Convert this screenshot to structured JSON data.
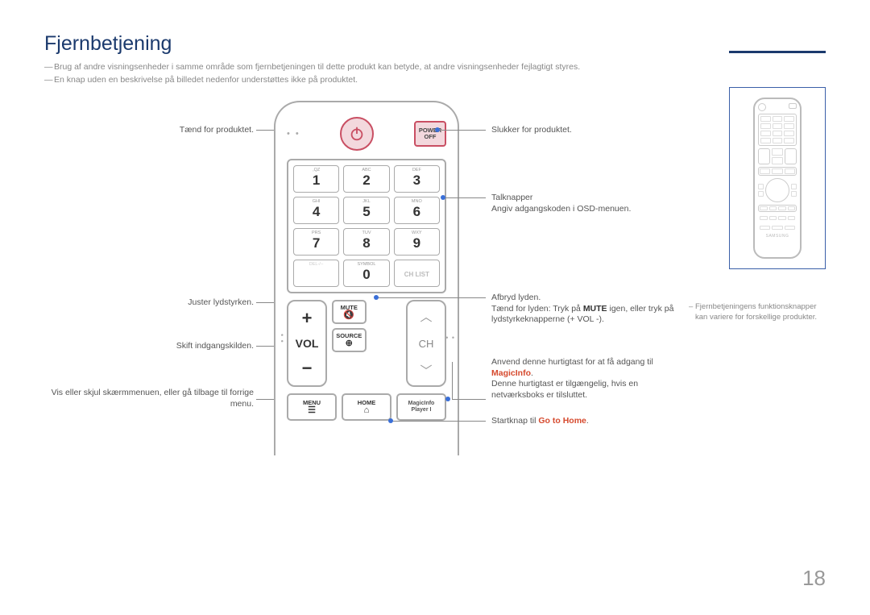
{
  "title": "Fjernbetjening",
  "notes": {
    "n1": "Brug af andre visningsenheder i samme område som fjernbetjeningen til dette produkt kan betyde, at andre visningsenheder fejlagtigt styres.",
    "n2": "En knap uden en beskrivelse på billedet nedenfor understøttes ikke på produktet."
  },
  "pageNumber": "18",
  "left": {
    "power_on": "Tænd for produktet.",
    "vol": "Juster lydstyrken.",
    "source": "Skift indgangskilden.",
    "menu": "Vis eller skjul skærmmenuen, eller gå tilbage til forrige menu."
  },
  "right": {
    "power_off": "Slukker for produktet.",
    "numbers_title": "Talknapper",
    "numbers_desc": "Angiv adgangskoden i OSD-menuen.",
    "mute_title": "Afbryd lyden.",
    "mute_desc1": "Tænd for lyden: Tryk på ",
    "mute_bold": "MUTE",
    "mute_desc2": " igen, eller tryk på lydstyrkeknapperne (+ VOL -).",
    "magic_desc1": "Anvend denne hurtigtast for at få adgang til ",
    "magic_red": "MagicInfo",
    "magic_desc2": "Denne hurtigtast er tilgængelig, hvis en netværksboks er tilsluttet.",
    "home_desc1": "Startknap til ",
    "home_red": "Go to Home"
  },
  "thumb_note": "Fjernbetjeningens funktionsknapper kan variere for forskellige produkter.",
  "remote": {
    "power_off_label1": "POWER",
    "power_off_label2": "OFF",
    "keys": [
      {
        "sub": ",QZ",
        "num": "1"
      },
      {
        "sub": "ABC",
        "num": "2"
      },
      {
        "sub": "DEF",
        "num": "3"
      },
      {
        "sub": "GHI",
        "num": "4"
      },
      {
        "sub": "JKL",
        "num": "5"
      },
      {
        "sub": "MNO",
        "num": "6"
      },
      {
        "sub": "PRS",
        "num": "7"
      },
      {
        "sub": "TUV",
        "num": "8"
      },
      {
        "sub": "WXY",
        "num": "9"
      },
      {
        "sub": "DEL-/--",
        "num": ""
      },
      {
        "sub": "SYMBOL",
        "num": "0"
      },
      {
        "sub": "",
        "num": "CH LIST"
      }
    ],
    "vol_label": "VOL",
    "ch_label": "CH",
    "mute_label": "MUTE",
    "source_label": "SOURCE",
    "menu_label": "MENU",
    "home_label": "HOME",
    "magic_label1": "MagicInfo",
    "magic_label2": "Player I",
    "brand": "SAMSUNG"
  }
}
